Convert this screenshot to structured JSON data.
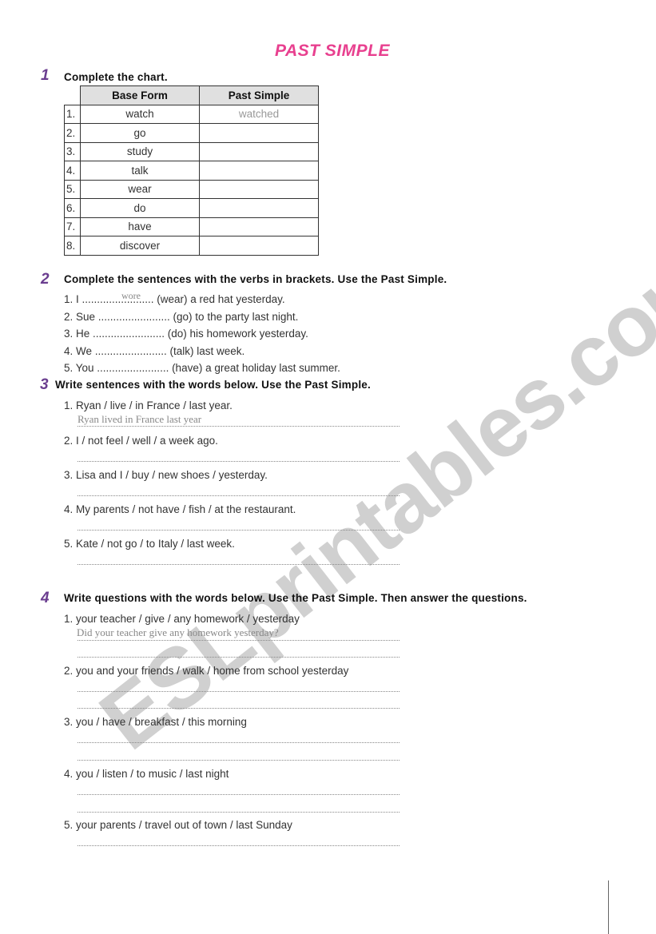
{
  "title": "PAST SIMPLE",
  "watermark": "ESLprintables.com",
  "section1": {
    "number": "1",
    "instruction": "Complete the chart.",
    "headers": [
      "Base Form",
      "Past Simple"
    ],
    "rows": [
      {
        "index": "1.",
        "base": "watch",
        "past": "watched"
      },
      {
        "index": "2.",
        "base": "go",
        "past": ""
      },
      {
        "index": "3.",
        "base": "study",
        "past": ""
      },
      {
        "index": "4.",
        "base": "talk",
        "past": ""
      },
      {
        "index": "5.",
        "base": "wear",
        "past": ""
      },
      {
        "index": "6.",
        "base": "do",
        "past": ""
      },
      {
        "index": "7.",
        "base": "have",
        "past": ""
      },
      {
        "index": "8.",
        "base": "discover",
        "past": ""
      }
    ]
  },
  "section2": {
    "number": "2",
    "instruction": "Complete the sentences with the verbs in brackets. Use the Past Simple.",
    "example_answer": "wore",
    "sentences": [
      "1. I ........................ (wear) a red hat yesterday.",
      "2. Sue ........................ (go) to the party last night.",
      "3. He ........................ (do) his homework yesterday.",
      "4. We ........................ (talk) last week.",
      "5. You ........................ (have) a great holiday last summer."
    ]
  },
  "section3": {
    "number": "3",
    "instruction": "Write sentences with the words below. Use the Past Simple.",
    "example_answer": "Ryan lived in France last year",
    "prompts": [
      "1. Ryan / live / in France / last year.",
      "2. I / not feel / well / a week ago.",
      "3. Lisa and I / buy / new shoes / yesterday.",
      "4. My parents / not have / fish / at the restaurant.",
      "5. Kate / not go / to Italy / last week."
    ]
  },
  "section4": {
    "number": "4",
    "instruction": "Write questions with the words below. Use the Past Simple. Then answer the questions.",
    "example_answer": "Did your teacher give any homework yesterday?",
    "prompts": [
      "1. your teacher / give / any homework / yesterday",
      "2. you and your friends / walk / home from school yesterday",
      "3. you / have / breakfast / this morning",
      "4. you / listen / to music / last night",
      "5. your parents / travel out of town / last Sunday"
    ]
  }
}
